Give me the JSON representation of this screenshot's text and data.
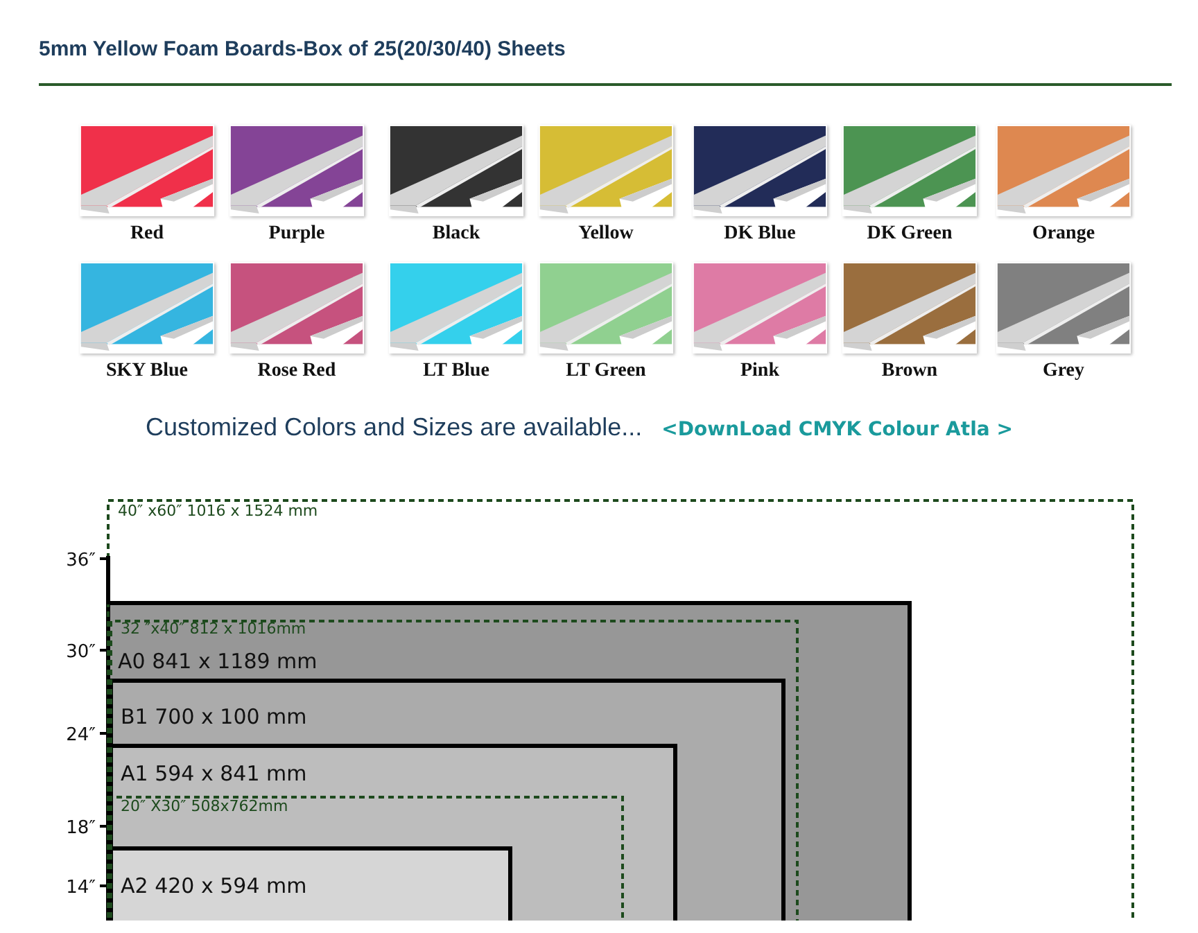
{
  "title": "5mm Yellow Foam Boards-Box of 25(20/30/40) Sheets",
  "swatches": [
    {
      "label": "Red",
      "color": "#f0304a"
    },
    {
      "label": "Purple",
      "color": "#844496"
    },
    {
      "label": "Black",
      "color": "#333333"
    },
    {
      "label": "Yellow",
      "color": "#d6bd35"
    },
    {
      "label": "DK Blue",
      "color": "#222c58"
    },
    {
      "label": "DK Green",
      "color": "#4c9452"
    },
    {
      "label": "Orange",
      "color": "#de8850"
    },
    {
      "label": "SKY Blue",
      "color": "#35b5e0"
    },
    {
      "label": "Rose Red",
      "color": "#c6527e"
    },
    {
      "label": "LT Blue",
      "color": "#34d0ec"
    },
    {
      "label": "LT Green",
      "color": "#90d090"
    },
    {
      "label": "Pink",
      "color": "#de7ba5"
    },
    {
      "label": "Brown",
      "color": "#9a6e3e"
    },
    {
      "label": "Grey",
      "color": "#808080"
    }
  ],
  "notice": {
    "text": "Customized Colors and Sizes are available...",
    "link": "<DownLoad CMYK Colour Atla >"
  },
  "size_chart": {
    "ticks": [
      "36″",
      "30″",
      "24″",
      "18″",
      "14″"
    ],
    "frames": [
      {
        "kind": "dashed",
        "label": "40″ x60″ 1016 x 1524 mm"
      },
      {
        "kind": "dashed",
        "label": "32 ″x40″ 812 x 1016mm"
      },
      {
        "kind": "solid",
        "label": "A0 841 x 1189 mm"
      },
      {
        "kind": "solid",
        "label": "B1 700 x 100 mm"
      },
      {
        "kind": "solid",
        "label": "A1 594 x 841 mm"
      },
      {
        "kind": "dashed",
        "label": "20″ X30″ 508x762mm"
      },
      {
        "kind": "solid",
        "label": "A2 420 x 594 mm"
      }
    ]
  }
}
